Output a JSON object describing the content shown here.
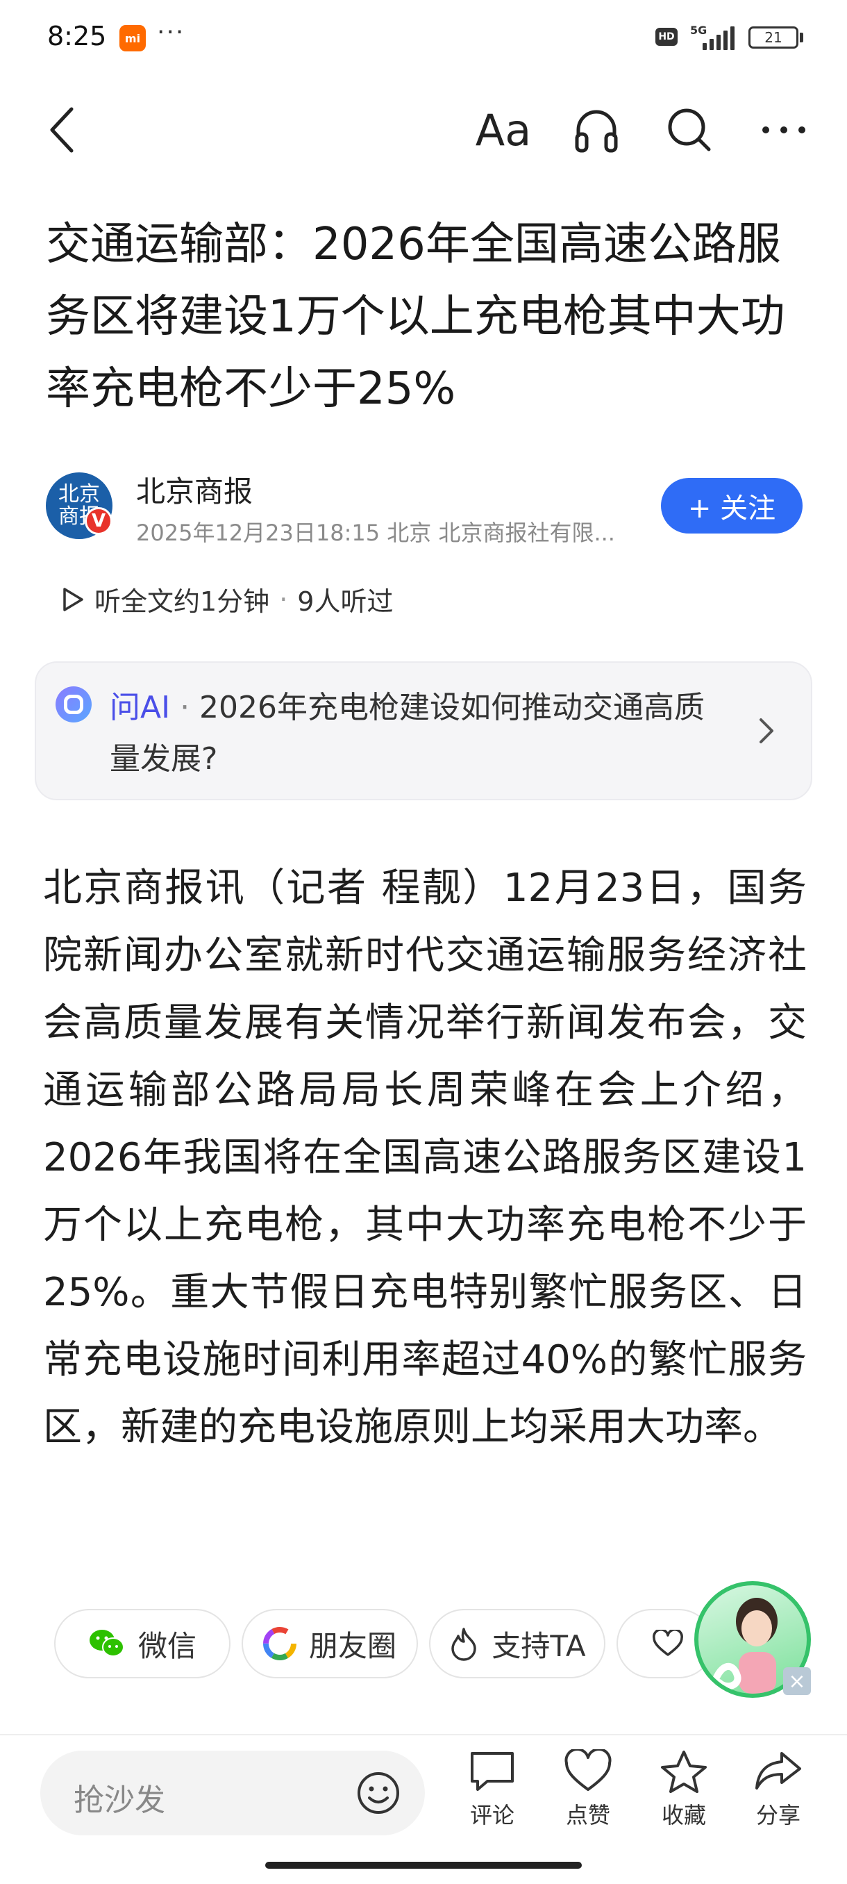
{
  "status_bar": {
    "time": "8:25",
    "app_badge": "mi",
    "more": "···",
    "hd": "HD",
    "network": "5G",
    "battery": "21"
  },
  "toolbar": {
    "font_label": "Aa",
    "icons": [
      "back-icon",
      "font-size-icon",
      "headphones-icon",
      "search-icon",
      "more-icon"
    ]
  },
  "article": {
    "title": "交通运输部：2026年全国高速公路服务区将建设1万个以上充电枪其中大功率充电枪不少于25%",
    "author": {
      "name": "北京商报",
      "avatar_text": "北京商报",
      "verified_mark": "V",
      "meta": "2025年12月23日18:15 北京 北京商报社有限..."
    },
    "follow_label": "+ 关注",
    "listen": {
      "label": "听全文约1分钟",
      "listeners": "9人听过"
    },
    "ai": {
      "label": "问AI",
      "question": "2026年充电枪建设如何推动交通高质量发展?"
    },
    "body": "北京商报讯（记者 程靓）12月23日，国务院新闻办公室就新时代交通运输服务经济社会高质量发展有关情况举行新闻发布会，交通运输部公路局局长周荣峰在会上介绍，2026年我国将在全国高速公路服务区建设1万个以上充电枪，其中大功率充电枪不少于25%。重大节假日充电特别繁忙服务区、日常充电设施时间利用率超过40%的繁忙服务区，新建的充电设施原则上均采用大功率。"
  },
  "share": {
    "wechat": "微信",
    "moments": "朋友圈",
    "support": "支持TA"
  },
  "bottom_bar": {
    "comment_placeholder": "抢沙发",
    "actions": {
      "comment": "评论",
      "like": "点赞",
      "favorite": "收藏",
      "share": "分享"
    }
  },
  "colors": {
    "accent": "#2f6cf6",
    "ai_label": "#4a4ee8",
    "verified": "#e8332b",
    "wechat": "#2dc100"
  }
}
